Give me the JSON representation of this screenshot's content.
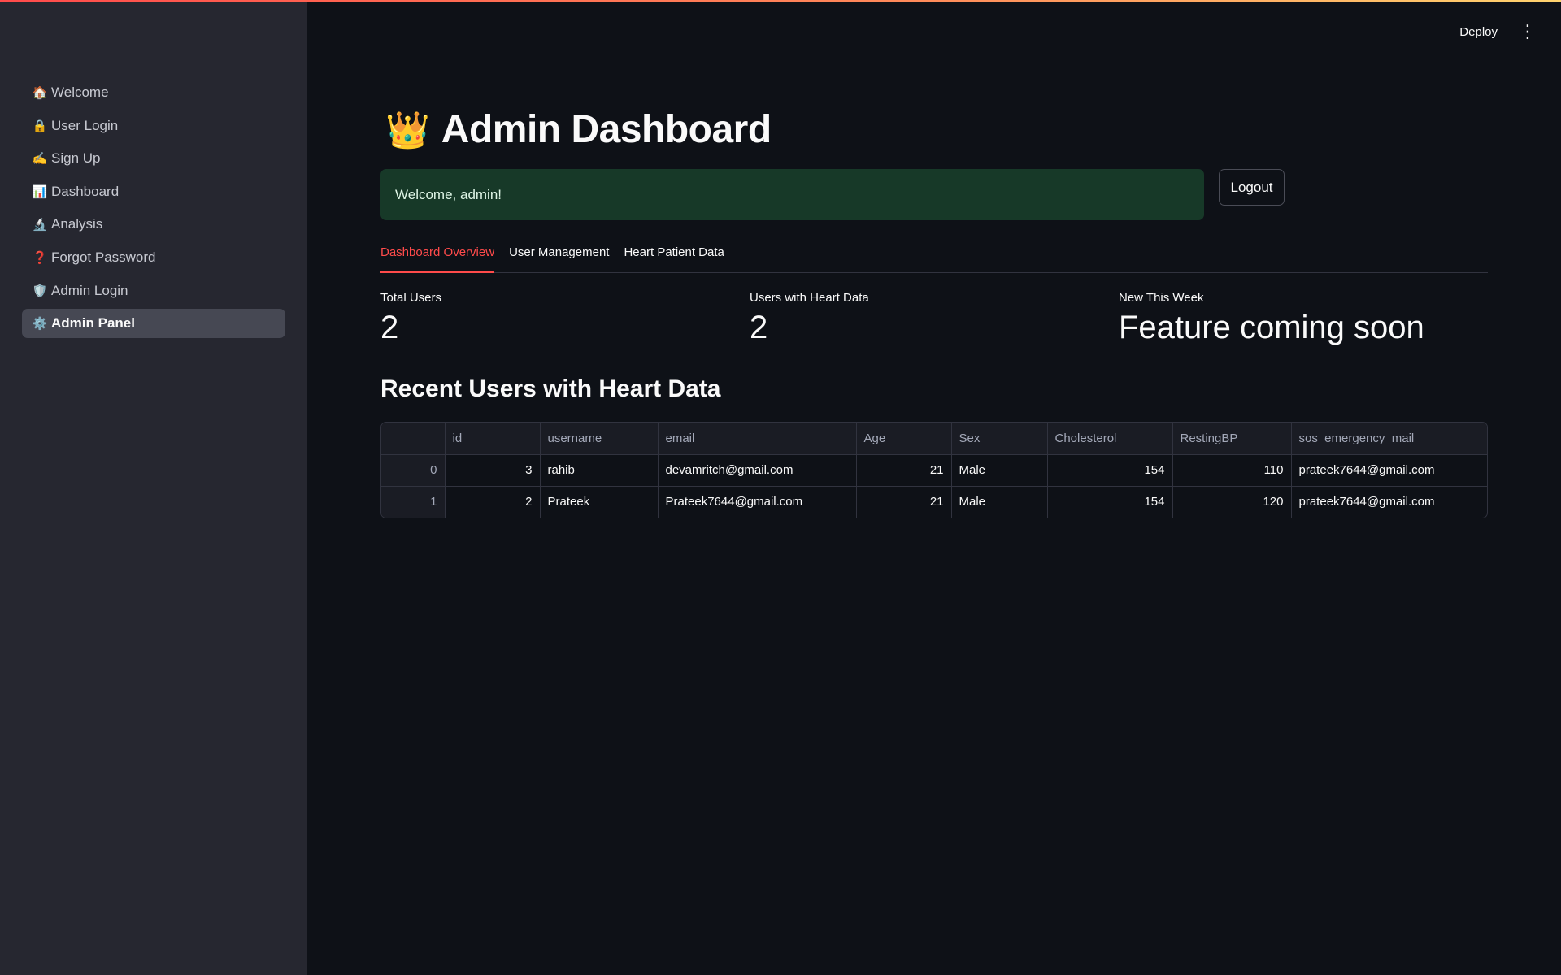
{
  "sidebar": {
    "items": [
      {
        "icon": "🏠",
        "icon_name": "house-icon",
        "label": "Welcome"
      },
      {
        "icon": "🔒",
        "icon_name": "lock-icon",
        "label": "User Login"
      },
      {
        "icon": "✍️",
        "icon_name": "writing-hand-icon",
        "label": "Sign Up"
      },
      {
        "icon": "📊",
        "icon_name": "bar-chart-icon",
        "label": "Dashboard"
      },
      {
        "icon": "🔬",
        "icon_name": "microscope-icon",
        "label": "Analysis"
      },
      {
        "icon": "❓",
        "icon_name": "question-icon",
        "label": "Forgot Password"
      },
      {
        "icon": "🛡️",
        "icon_name": "shield-icon",
        "label": "Admin Login"
      },
      {
        "icon": "⚙️",
        "icon_name": "gear-icon",
        "label": "Admin Panel"
      }
    ]
  },
  "header": {
    "deploy_label": "Deploy",
    "menu_icon": "⋮"
  },
  "main": {
    "title_emoji": "👑",
    "title": "Admin Dashboard",
    "welcome_message": "Welcome, admin!",
    "logout_label": "Logout",
    "tabs": [
      {
        "label": "Dashboard Overview"
      },
      {
        "label": "User Management"
      },
      {
        "label": "Heart Patient Data"
      }
    ],
    "metrics": [
      {
        "label": "Total Users",
        "value": "2"
      },
      {
        "label": "Users with Heart Data",
        "value": "2"
      },
      {
        "label": "New This Week",
        "value": "Feature coming soon"
      }
    ],
    "subheader": "Recent Users with Heart Data",
    "table": {
      "columns": [
        "",
        "id",
        "username",
        "email",
        "Age",
        "Sex",
        "Cholesterol",
        "RestingBP",
        "sos_emergency_mail"
      ],
      "rows": [
        [
          "0",
          "3",
          "rahib",
          "devamritch@gmail.com",
          "21",
          "Male",
          "154",
          "110",
          "prateek7644@gmail.com"
        ],
        [
          "1",
          "2",
          "Prateek",
          "Prateek7644@gmail.com",
          "21",
          "Male",
          "154",
          "120",
          "prateek7644@gmail.com"
        ]
      ]
    }
  },
  "colors": {
    "accent": "#ff4b4b",
    "sidebar_bg": "#262730",
    "main_bg": "#0e1117",
    "success_bg": "#173928"
  }
}
